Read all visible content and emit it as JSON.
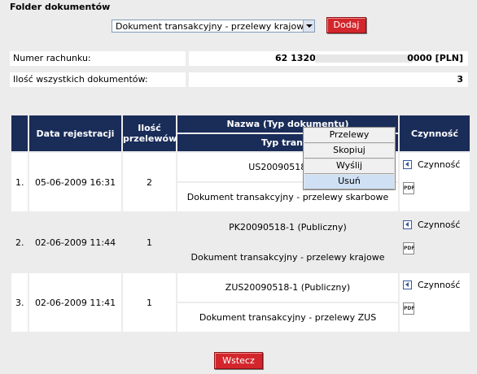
{
  "header": {
    "title": "Folder dokumentów"
  },
  "doc_type_select": {
    "value": "Dokument transakcyjny - przelewy krajowe"
  },
  "add_button": "Dodaj",
  "info": {
    "account_label": "Numer rachunku:",
    "account_prefix": "62 1320",
    "account_suffix": "0000 [PLN]",
    "count_label": "Ilość wszystkich dokumentów:",
    "count_value": "3"
  },
  "table": {
    "headers": {
      "date": "Data rejestracji",
      "transfers": "Ilość przelewów",
      "name": "Nazwa (Typ dokumentu)",
      "type_sub": "Typ transa",
      "action": "Czynność"
    },
    "rows": [
      {
        "no": "1.",
        "date": "05-06-2009 16:31",
        "transfers": "2",
        "name": "US20090518-1 (P",
        "type": "Dokument transakcyjny - przelewy skarbowe",
        "action": "Czynność"
      },
      {
        "no": "2.",
        "date": "02-06-2009 11:44",
        "transfers": "1",
        "name": "PK20090518-1 (Publiczny)",
        "type": "Dokument transakcyjny - przelewy krajowe",
        "action": "Czynność"
      },
      {
        "no": "3.",
        "date": "02-06-2009 11:41",
        "transfers": "1",
        "name": "ZUS20090518-1 (Publiczny)",
        "type": "Dokument transakcyjny - przelewy ZUS",
        "action": "Czynność"
      }
    ]
  },
  "context_menu": {
    "items": [
      "Przelewy",
      "Skopiuj",
      "Wyślij",
      "Usuń"
    ],
    "highlighted": "Usuń"
  },
  "pdf_label": "PDF",
  "back_button": "Wstecz"
}
